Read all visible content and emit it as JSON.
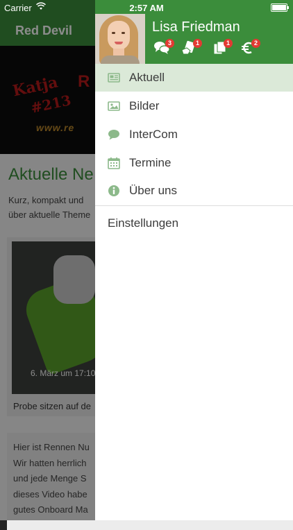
{
  "status_bar": {
    "carrier": "Carrier",
    "time": "2:57 AM"
  },
  "background": {
    "app_title": "Red Devil",
    "banner_text_1": "Katja",
    "banner_text_2": "#213",
    "banner_text_3": "R",
    "banner_url": "www.re",
    "heading": "Aktuelle Ne",
    "description_lines": [
      "Kurz, kompakt und",
      "über aktuelle Theme"
    ],
    "photo_caption": "6. März um 17:10",
    "card1_text": "Probe sitzen auf de",
    "card2_lines": [
      "Hier ist Rennen Nu",
      "Wir hatten herrlich",
      "und jede Menge S",
      "dieses Video habe",
      "gutes Onboard Ma"
    ]
  },
  "drawer": {
    "user_name": "Lisa Friedman",
    "header_icons": [
      {
        "icon": "chat-bubbles-icon",
        "badge": "3"
      },
      {
        "icon": "hand-card-icon",
        "badge": "1"
      },
      {
        "icon": "documents-icon",
        "badge": "1"
      },
      {
        "icon": "euro-icon",
        "badge": "2"
      }
    ],
    "menu": [
      {
        "label": "Aktuell",
        "icon": "newspaper-icon",
        "active": true
      },
      {
        "label": "Bilder",
        "icon": "image-icon",
        "active": false
      },
      {
        "label": "InterCom",
        "icon": "chat-bubble-icon",
        "active": false
      },
      {
        "label": "Termine",
        "icon": "calendar-icon",
        "active": false
      },
      {
        "label": "Über uns",
        "icon": "info-icon",
        "active": false
      }
    ],
    "settings_label": "Einstellungen"
  },
  "colors": {
    "brand_green": "#3b8d3b",
    "active_item_bg": "#dbe9d8",
    "badge_red": "#e23a33"
  }
}
